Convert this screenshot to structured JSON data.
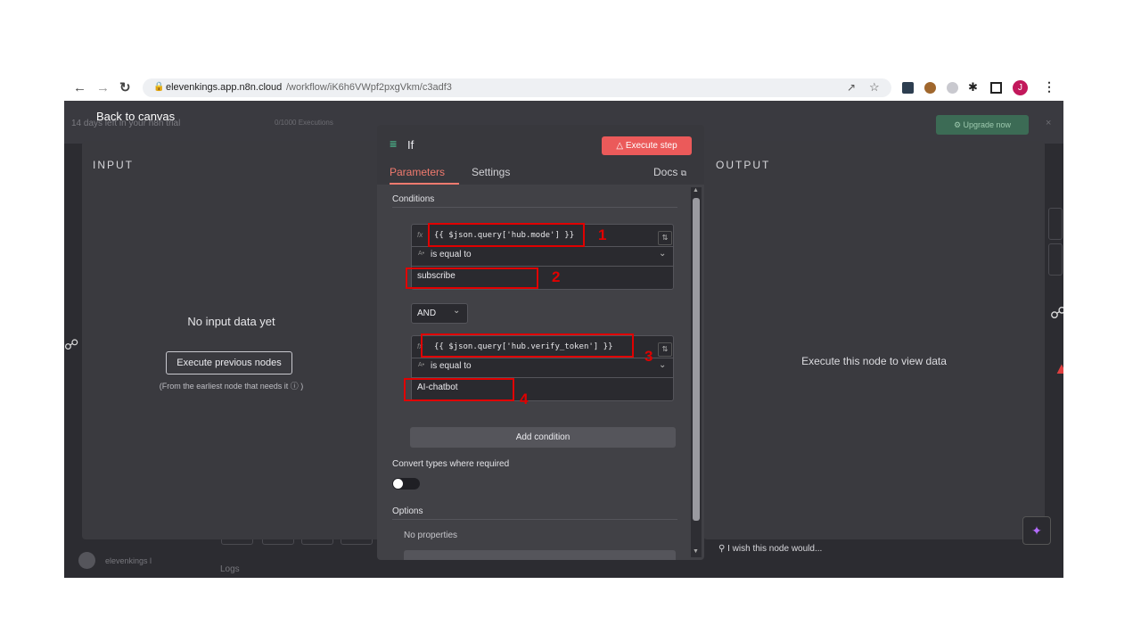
{
  "browser": {
    "url_domain": "elevenkings.app.n8n.cloud",
    "url_path": "/workflow/iK6h6VWpf2pxgVkm/c3adf3",
    "profile_initial": "J"
  },
  "app_background": {
    "trial_text": "14 days left in your n8n trial",
    "executions": "0/1000 Executions",
    "upgrade_label": "Upgrade now",
    "user_name": "elevenkings l",
    "logs_label": "Logs"
  },
  "back_label": "Back to canvas",
  "input_panel": {
    "title": "INPUT",
    "empty_message": "No input data yet",
    "execute_prev_label": "Execute previous nodes",
    "hint": "(From the earliest node that needs it ⓘ )"
  },
  "output_panel": {
    "title": "OUTPUT",
    "empty_message": "Execute this node to view data",
    "feedback": "I wish this node would..."
  },
  "node": {
    "name": "If",
    "execute_label": "Execute step",
    "tabs": [
      "Parameters",
      "Settings"
    ],
    "docs_label": "Docs",
    "conditions_label": "Conditions",
    "conditions": [
      {
        "left": "{{ $json.query['hub.mode'] }}",
        "operator": "is equal to",
        "right": "subscribe"
      },
      {
        "left": "{{ $json.query['hub.verify_token'] }}",
        "operator": "is equal to",
        "right": "AI-chatbot"
      }
    ],
    "combinator": "AND",
    "add_condition_label": "Add condition",
    "convert_label": "Convert types where required",
    "options_label": "Options",
    "no_properties": "No properties"
  },
  "annotations": [
    "1",
    "2",
    "3",
    "4"
  ],
  "colors": {
    "accent": "#eb5a5a",
    "annotation": "#e00000",
    "panel_bg": "#3a3a3f"
  }
}
